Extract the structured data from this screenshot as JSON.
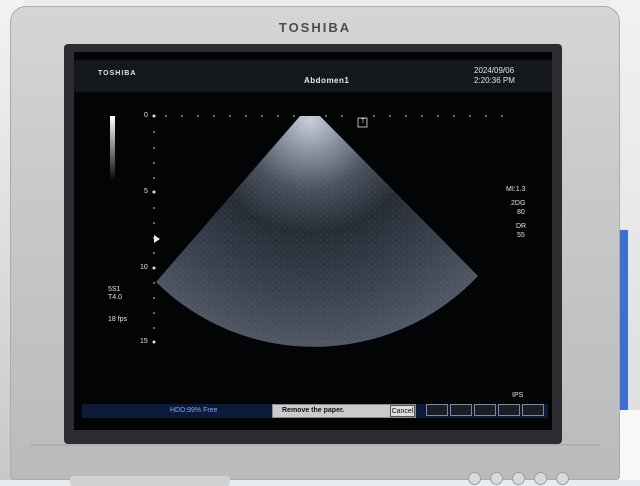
{
  "monitor": {
    "bezel_brand": "TOSHIBA"
  },
  "header": {
    "brand": "TOSHIBA",
    "preset": "Abdomen1",
    "date": "2024/09/06",
    "time": "2:20:36 PM"
  },
  "depth_scale": {
    "labels": [
      "0",
      "5",
      "10",
      "15"
    ],
    "focus_marker": "triangle-right-icon"
  },
  "image": {
    "top_marker": "T"
  },
  "right_panel": {
    "mi": "MI:1.3",
    "mode": "2DG",
    "gain": "80",
    "dr_label": "DR",
    "dr_value": "55"
  },
  "left_panel": {
    "probe": "5S1",
    "tissue": "T4.0",
    "fps": "18 fps"
  },
  "status": {
    "hdd": "HDD:99% Free",
    "message": "Remove the paper.",
    "cancel_label": "Cancel",
    "ips": "IPS"
  },
  "colors": {
    "screen_bg": "#030405",
    "status_bar": "#0d1b3a",
    "hdd_text": "#7ea6ff"
  }
}
